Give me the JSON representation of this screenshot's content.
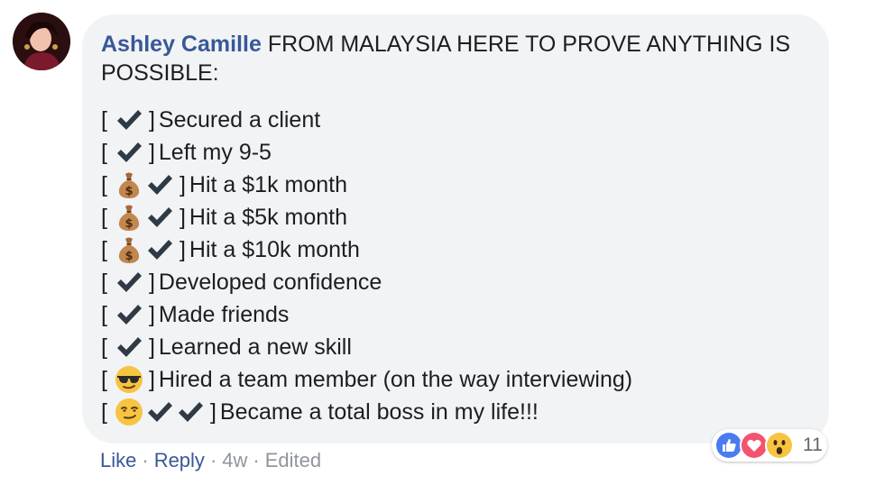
{
  "comment": {
    "author": "Ashley Camille",
    "text": "FROM MALAYSIA HERE TO PROVE ANYTHING IS POSSIBLE:",
    "items": [
      {
        "icons": [
          "check-icon"
        ],
        "label": "Secured a client"
      },
      {
        "icons": [
          "check-icon"
        ],
        "label": "Left my 9-5"
      },
      {
        "icons": [
          "money-bag-icon",
          "check-icon"
        ],
        "label": "Hit a $1k month"
      },
      {
        "icons": [
          "money-bag-icon",
          "check-icon"
        ],
        "label": "Hit a $5k month"
      },
      {
        "icons": [
          "money-bag-icon",
          "check-icon"
        ],
        "label": "Hit a $10k month"
      },
      {
        "icons": [
          "check-icon"
        ],
        "label": "Developed confidence"
      },
      {
        "icons": [
          "check-icon"
        ],
        "label": "Made friends"
      },
      {
        "icons": [
          "check-icon"
        ],
        "label": "Learned a new skill"
      },
      {
        "icons": [
          "sunglasses-face-icon"
        ],
        "label": "Hired a team member (on the way interviewing)"
      },
      {
        "icons": [
          "smirk-face-icon",
          "check-icon",
          "check-icon"
        ],
        "label": "Became a total boss in my life!!!"
      }
    ],
    "actions": {
      "like": "Like",
      "reply": "Reply",
      "time": "4w",
      "edited": "Edited",
      "separator": "·"
    },
    "reactions": {
      "icons": [
        "like-reaction-icon",
        "love-reaction-icon",
        "wow-reaction-icon"
      ],
      "count": "11"
    }
  },
  "colors": {
    "link": "#385898",
    "bubble": "#f2f3f5",
    "meta": "#90949c"
  }
}
